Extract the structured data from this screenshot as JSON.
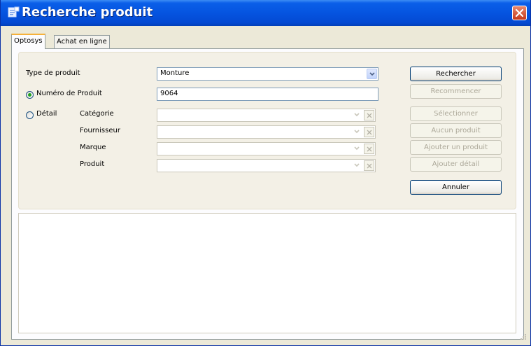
{
  "window": {
    "title": "Recherche produit",
    "title_icon": "app-window-icon",
    "close_icon": "close-icon"
  },
  "tabs": [
    {
      "label": "Optosys",
      "selected": true
    },
    {
      "label": "Achat en ligne",
      "selected": false
    }
  ],
  "form": {
    "type_produit": {
      "label": "Type de produit",
      "value": "Monture"
    },
    "numero_produit": {
      "label": "Numéro de Produit",
      "value": "9064",
      "selected": true
    },
    "detail": {
      "label": "Détail",
      "selected": false,
      "fields": [
        {
          "label": "Catégorie",
          "value": ""
        },
        {
          "label": "Fournisseur",
          "value": ""
        },
        {
          "label": "Marque",
          "value": ""
        },
        {
          "label": "Produit",
          "value": ""
        }
      ]
    }
  },
  "buttons": [
    {
      "label": "Rechercher",
      "enabled": true
    },
    {
      "label": "Recommencer",
      "enabled": false
    },
    {
      "label": "Sélectionner",
      "enabled": false
    },
    {
      "label": "Aucun produit",
      "enabled": false
    },
    {
      "label": "Ajouter un produit",
      "enabled": false
    },
    {
      "label": "Ajouter détail",
      "enabled": false
    },
    {
      "label": "Annuler",
      "enabled": true
    }
  ],
  "colors": {
    "titlebar": "#0554e0",
    "dialog_bg": "#ece9d8",
    "radio_check": "#21a121",
    "close_button": "#c6391b",
    "tab_highlight": "#f6b13a"
  }
}
